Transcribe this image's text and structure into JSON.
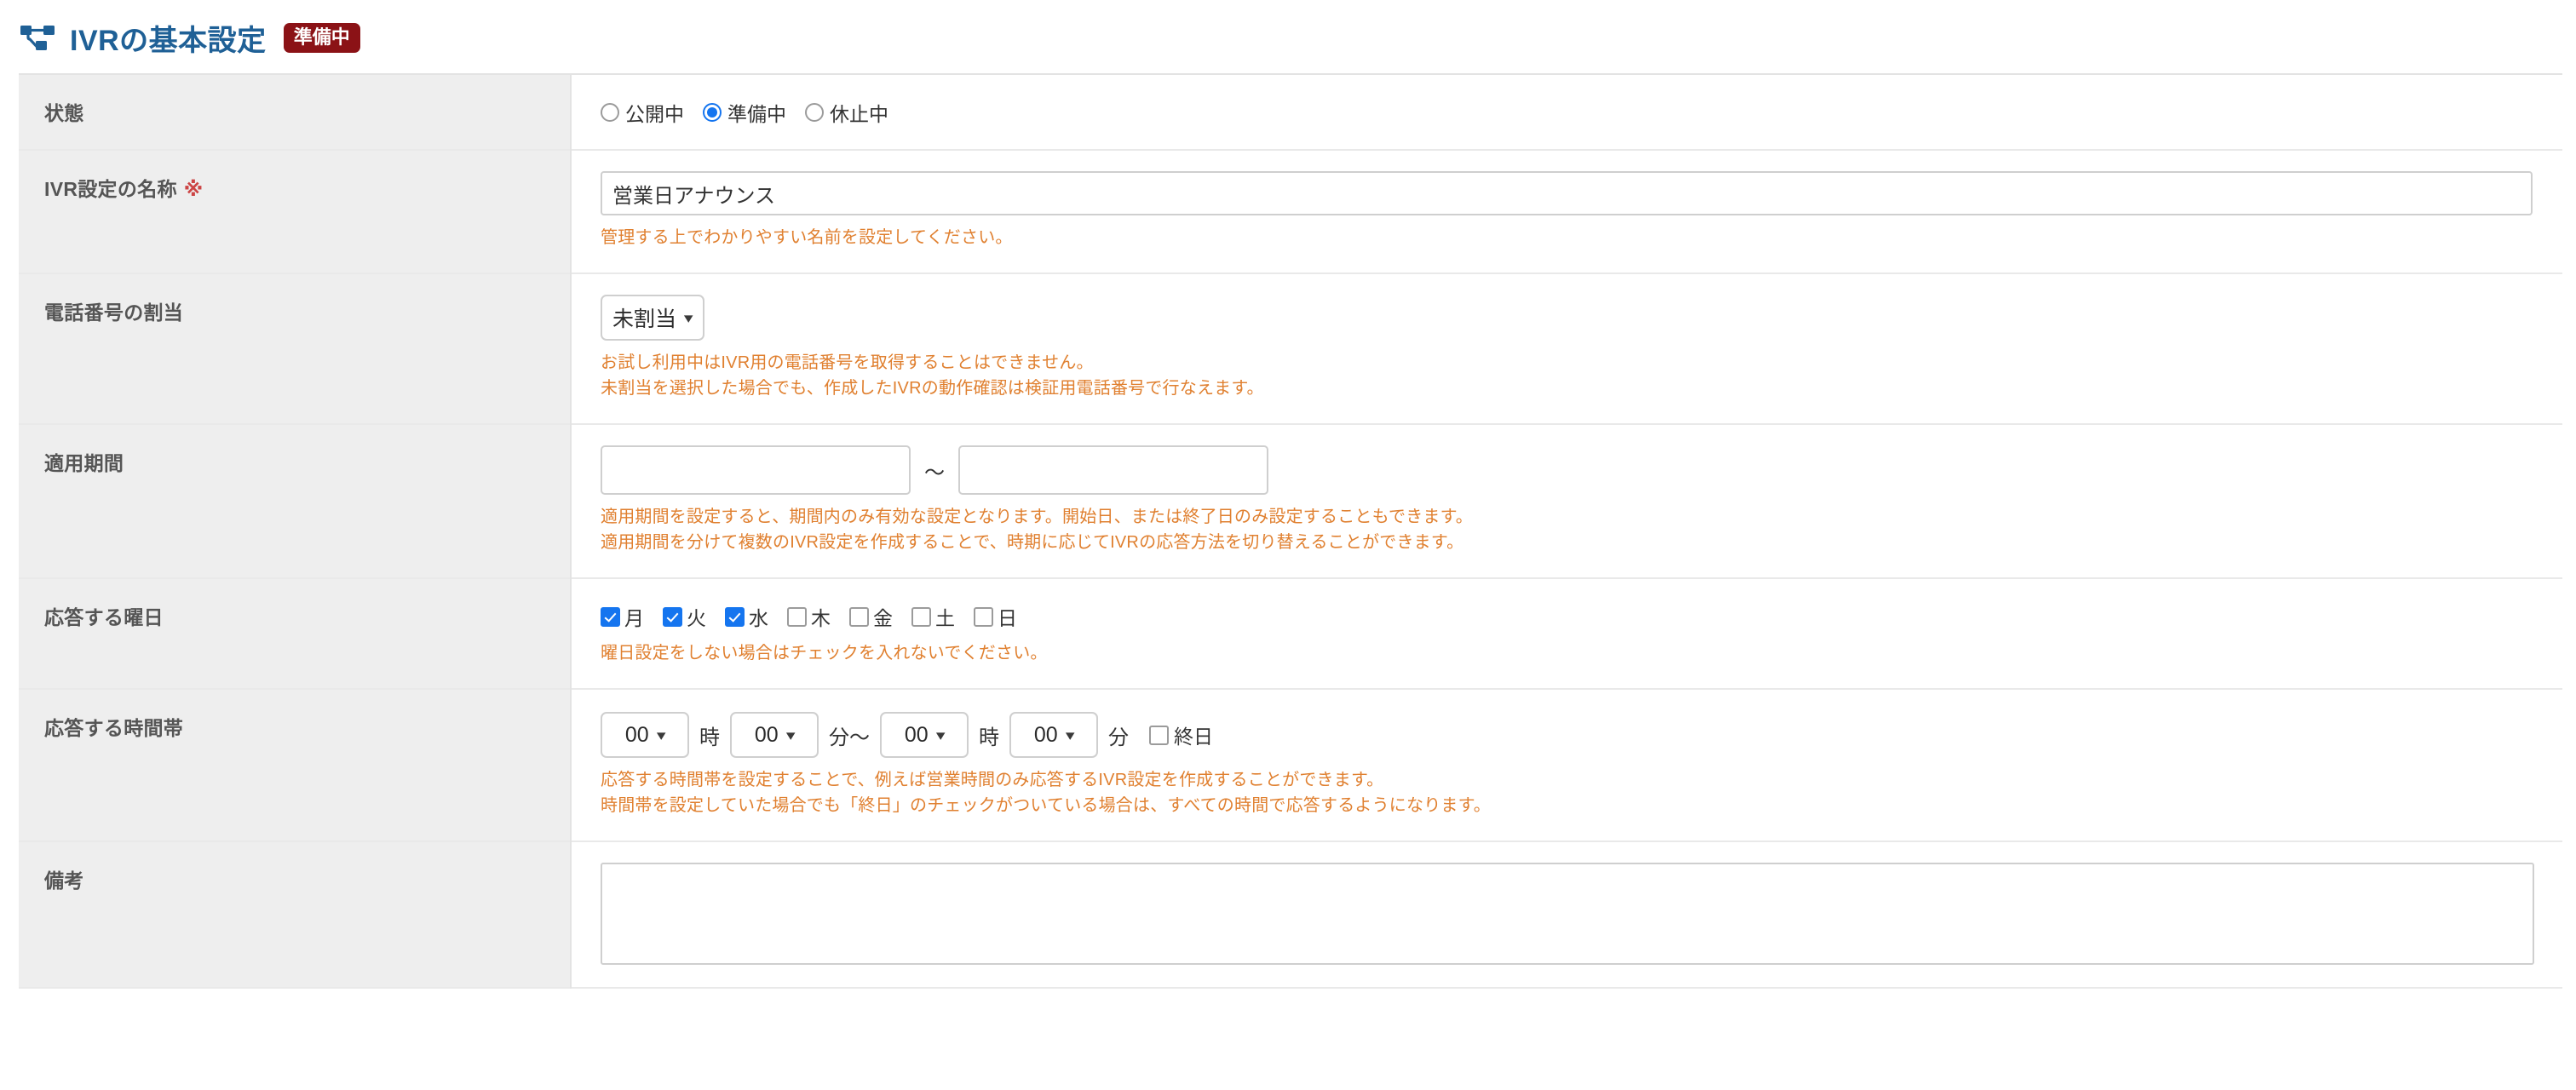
{
  "header": {
    "icon": "sitemap-tree-icon",
    "title": "IVRの基本設定",
    "status_badge": "準備中",
    "badge_color": "#8b1216",
    "title_color": "#1f6096"
  },
  "colors": {
    "accent_blue": "#1575ef",
    "help_orange": "#e08030",
    "required_red": "#cc4444",
    "label_bg": "#eeeeee"
  },
  "rows": {
    "state": {
      "label": "状態",
      "options": [
        {
          "label": "公開中",
          "checked": false
        },
        {
          "label": "準備中",
          "checked": true
        },
        {
          "label": "休止中",
          "checked": false
        }
      ]
    },
    "name": {
      "label": "IVR設定の名称",
      "required_mark": "※",
      "value": "営業日アナウンス",
      "placeholder": "",
      "help": [
        "管理する上でわかりやすい名前を設定してください。"
      ]
    },
    "phone_assign": {
      "label": "電話番号の割当",
      "selected": "未割当",
      "options": [
        "未割当"
      ],
      "help": [
        "お試し利用中はIVR用の電話番号を取得することはできません。",
        "未割当を選択した場合でも、作成したIVRの動作確認は検証用電話番号で行なえます。"
      ]
    },
    "period": {
      "label": "適用期間",
      "start_value": "",
      "start_placeholder": "",
      "separator": "～",
      "end_value": "",
      "end_placeholder": "",
      "help": [
        "適用期間を設定すると、期間内のみ有効な設定となります。開始日、または終了日のみ設定することもできます。",
        "適用期間を分けて複数のIVR設定を作成することで、時期に応じてIVRの応答方法を切り替えることができます。"
      ]
    },
    "weekdays": {
      "label": "応答する曜日",
      "options": [
        {
          "label": "月",
          "checked": true
        },
        {
          "label": "火",
          "checked": true
        },
        {
          "label": "水",
          "checked": true
        },
        {
          "label": "木",
          "checked": false
        },
        {
          "label": "金",
          "checked": false
        },
        {
          "label": "土",
          "checked": false
        },
        {
          "label": "日",
          "checked": false
        }
      ],
      "help": [
        "曜日設定をしない場合はチェックを入れないでください。"
      ]
    },
    "timeslot": {
      "label": "応答する時間帯",
      "start_hour": "00",
      "hour_unit": "時",
      "start_minute": "00",
      "minute_unit_sep": "分～",
      "end_hour": "00",
      "hour_unit2": "時",
      "end_minute": "00",
      "minute_unit": "分",
      "allday_label": "終日",
      "allday_checked": false,
      "help": [
        "応答する時間帯を設定することで、例えば営業時間のみ応答するIVR設定を作成することができます。",
        "時間帯を設定していた場合でも「終日」のチェックがついている場合は、すべての時間で応答するようになります。"
      ]
    },
    "remarks": {
      "label": "備考",
      "value": "",
      "placeholder": ""
    }
  }
}
